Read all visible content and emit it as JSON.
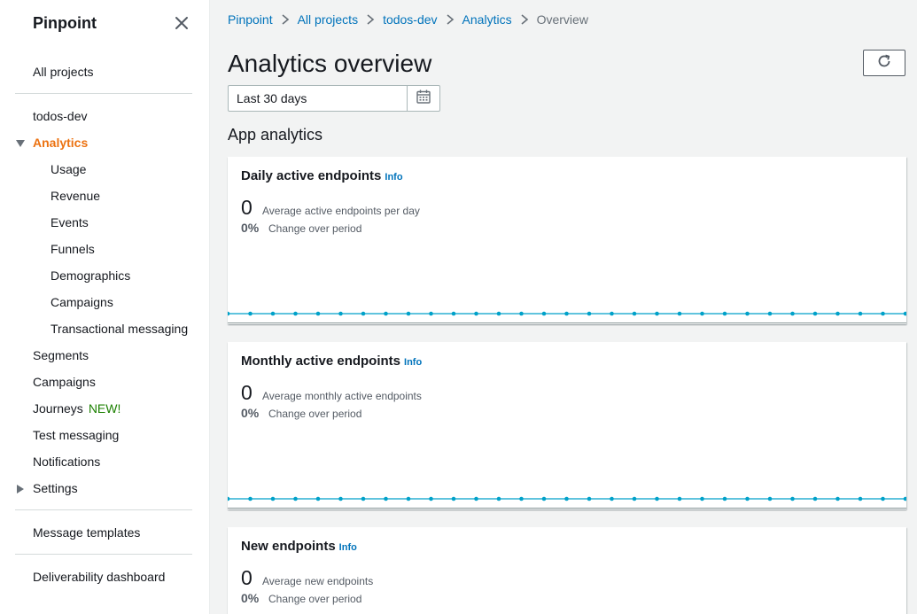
{
  "sidebar": {
    "title": "Pinpoint",
    "all_projects": "All projects",
    "project": "todos-dev",
    "analytics": "Analytics",
    "analytics_children": [
      "Usage",
      "Revenue",
      "Events",
      "Funnels",
      "Demographics",
      "Campaigns",
      "Transactional messaging"
    ],
    "segments": "Segments",
    "campaigns": "Campaigns",
    "journeys": "Journeys",
    "journeys_badge": "NEW!",
    "test_messaging": "Test messaging",
    "notifications": "Notifications",
    "settings": "Settings",
    "message_templates": "Message templates",
    "deliverability_dashboard": "Deliverability dashboard"
  },
  "breadcrumb": [
    "Pinpoint",
    "All projects",
    "todos-dev",
    "Analytics",
    "Overview"
  ],
  "page": {
    "title": "Analytics overview",
    "date_range": "Last 30 days",
    "section": "App analytics"
  },
  "cards": [
    {
      "title": "Daily active endpoints",
      "info": "Info",
      "value": "0",
      "value_desc": "Average active endpoints per day",
      "change": "0%",
      "change_desc": "Change over period"
    },
    {
      "title": "Monthly active endpoints",
      "info": "Info",
      "value": "0",
      "value_desc": "Average monthly active endpoints",
      "change": "0%",
      "change_desc": "Change over period"
    },
    {
      "title": "New endpoints",
      "info": "Info",
      "value": "0",
      "value_desc": "Average new endpoints",
      "change": "0%",
      "change_desc": "Change over period"
    }
  ],
  "icons": {
    "close": "close-icon",
    "caret_down": "caret-down-icon",
    "caret_right": "caret-right-icon",
    "refresh": "refresh-icon",
    "calendar": "calendar-icon",
    "chevron": "chevron-right-icon"
  },
  "colors": {
    "accent_active": "#ec7211",
    "link": "#0073bb",
    "new_badge": "#1d8102",
    "chart_line": "#00a1c9"
  },
  "chart_data": [
    {
      "type": "line",
      "series": [
        {
          "values": [
            0,
            0,
            0,
            0,
            0,
            0,
            0,
            0,
            0,
            0,
            0,
            0,
            0,
            0,
            0,
            0,
            0,
            0,
            0,
            0,
            0,
            0,
            0,
            0,
            0,
            0,
            0,
            0,
            0,
            0,
            0
          ]
        }
      ]
    },
    {
      "type": "line",
      "series": [
        {
          "values": [
            0,
            0,
            0,
            0,
            0,
            0,
            0,
            0,
            0,
            0,
            0,
            0,
            0,
            0,
            0,
            0,
            0,
            0,
            0,
            0,
            0,
            0,
            0,
            0,
            0,
            0,
            0,
            0,
            0,
            0,
            0
          ]
        }
      ]
    }
  ]
}
